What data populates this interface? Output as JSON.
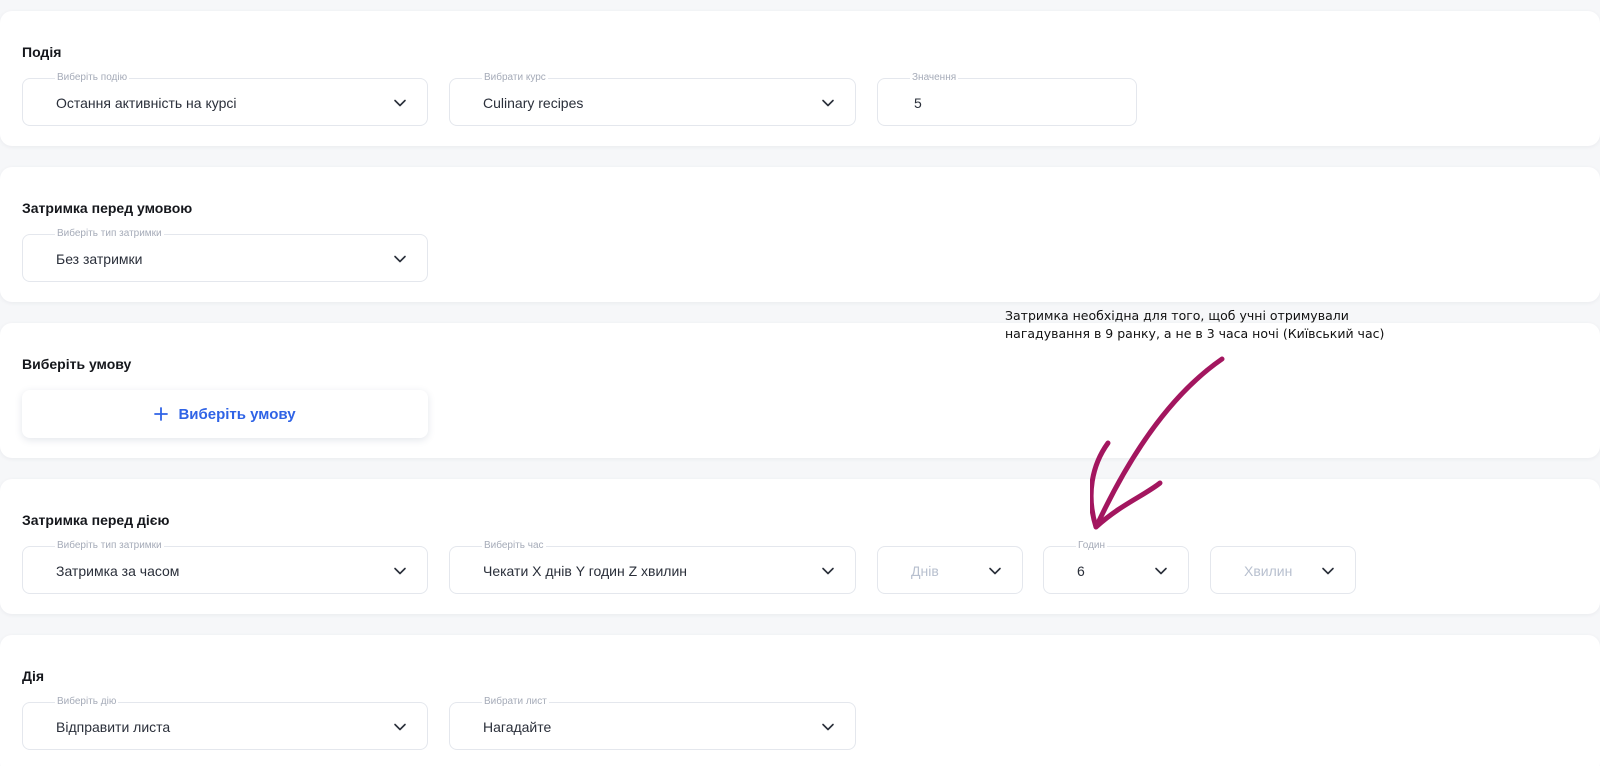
{
  "sections": {
    "event": {
      "title": "Подія",
      "fields": [
        {
          "label": "Виберіть подію",
          "value": "Остання активність на курсі"
        },
        {
          "label": "Вибрати курс",
          "value": "Culinary recipes"
        },
        {
          "label": "Значення",
          "value": "5"
        }
      ]
    },
    "delay_before_condition": {
      "title": "Затримка перед умовою",
      "fields": [
        {
          "label": "Виберіть тип затримки",
          "value": "Без затримки"
        }
      ]
    },
    "condition": {
      "title": "Виберіть умову",
      "add_button_label": "Виберіть умову",
      "add_icon": "plus-icon"
    },
    "delay_before_action": {
      "title": "Затримка перед дією",
      "fields": [
        {
          "label": "Виберіть тип затримки",
          "value": "Затримка за часом"
        },
        {
          "label": "Виберіть час",
          "value": "Чекати X днів Y годин Z хвилин"
        },
        {
          "label": "",
          "value": "Днів"
        },
        {
          "label": "Годин",
          "value": "6"
        },
        {
          "label": "",
          "value": "Хвилин"
        }
      ]
    },
    "action": {
      "title": "Дія",
      "fields": [
        {
          "label": "Виберіть дію",
          "value": "Відправити листа"
        },
        {
          "label": "Вибрати лист",
          "value": "Нагадайте"
        }
      ]
    }
  },
  "annotation": {
    "line1": "Затримка необхідна для того, щоб учні отримували",
    "line2": "нагадування в 9 ранку, а не в 3 часа ночі  (Київський час)",
    "arrow_color": "#a3165f"
  },
  "colors": {
    "accent": "#2f63e6",
    "placeholder": "#b8c0cf",
    "border": "#e4e7ed"
  }
}
